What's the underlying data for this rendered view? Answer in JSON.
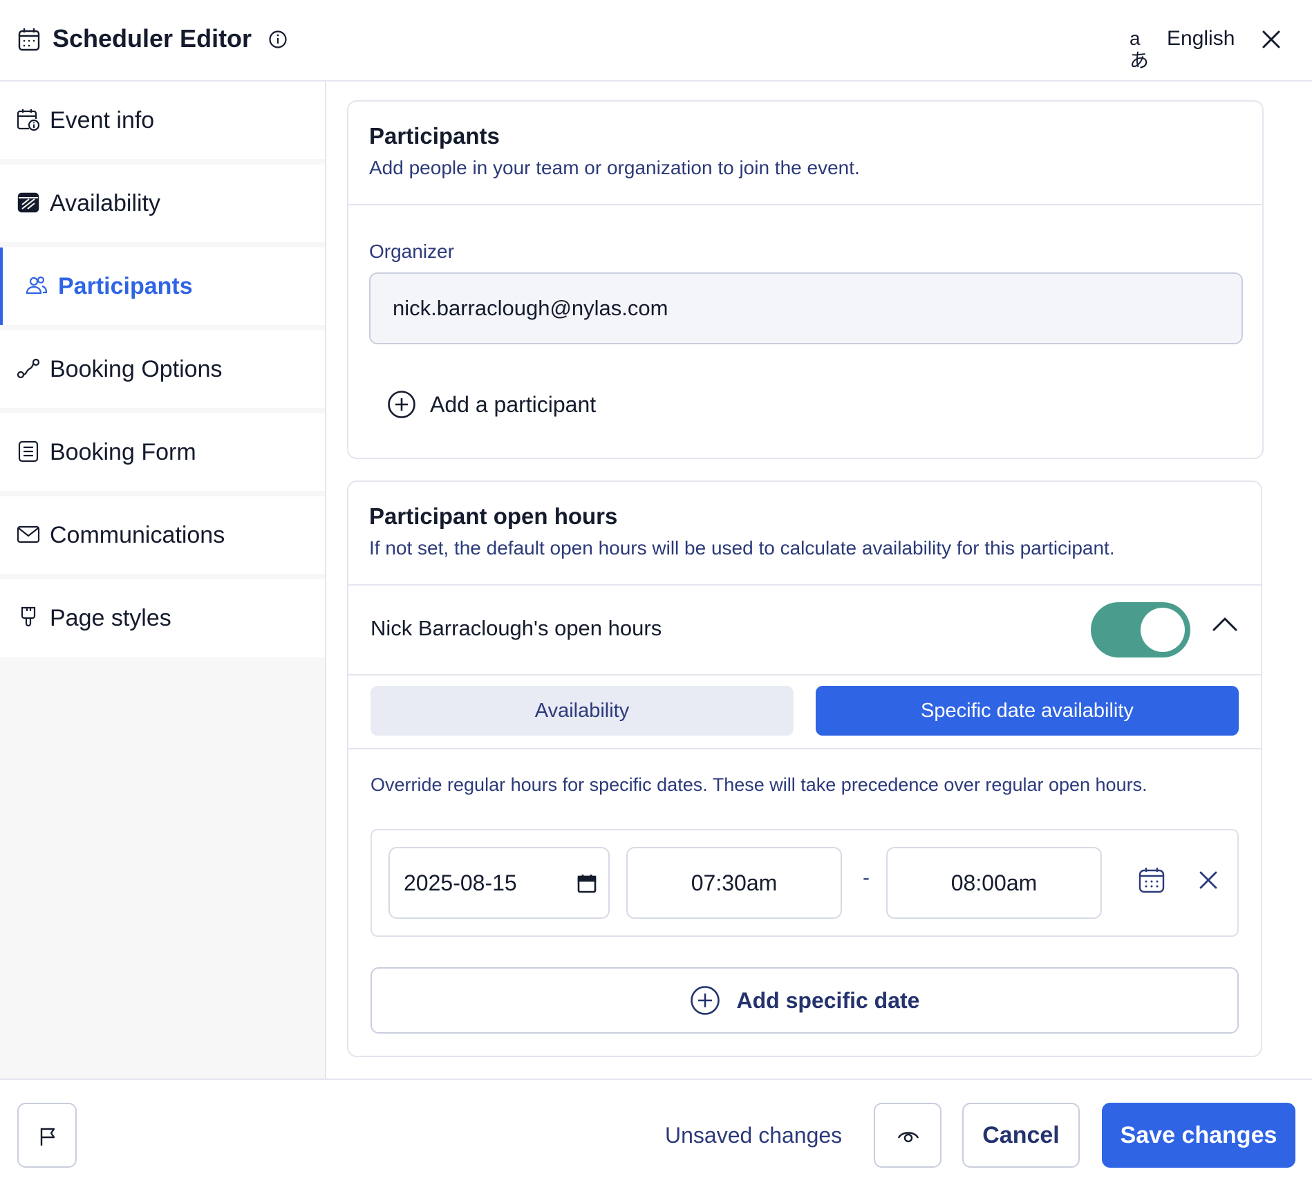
{
  "header": {
    "title": "Scheduler Editor",
    "language_glyph": "aあ",
    "language_label": "English"
  },
  "sidebar": {
    "items": [
      {
        "label": "Event info",
        "icon": "calendar-info-icon"
      },
      {
        "label": "Availability",
        "icon": "availability-icon"
      },
      {
        "label": "Participants",
        "icon": "users-icon",
        "active": true
      },
      {
        "label": "Booking Options",
        "icon": "route-icon"
      },
      {
        "label": "Booking Form",
        "icon": "form-icon"
      },
      {
        "label": "Communications",
        "icon": "mail-icon"
      },
      {
        "label": "Page styles",
        "icon": "paint-brush-icon"
      }
    ]
  },
  "participants_card": {
    "title": "Participants",
    "subtitle": "Add people in your team or organization to join the event.",
    "organizer_label": "Organizer",
    "organizer_value": "nick.barraclough@nylas.com",
    "add_participant_label": "Add a participant"
  },
  "open_hours_card": {
    "title": "Participant open hours",
    "subtitle": "If not set, the default open hours will be used to calculate availability for this participant.",
    "participant_label": "Nick Barraclough's open hours",
    "toggle_on": true,
    "tabs": [
      {
        "label": "Availability",
        "active": false
      },
      {
        "label": "Specific date availability",
        "active": true
      }
    ],
    "override_text": "Override regular hours for specific dates. These will take precedence over regular open hours.",
    "date_entry": {
      "date": "2025-08-15",
      "start_time": "07:30am",
      "separator": "-",
      "end_time": "08:00am"
    },
    "add_specific_date_label": "Add specific date"
  },
  "footer": {
    "unsaved_label": "Unsaved changes",
    "cancel_label": "Cancel",
    "save_label": "Save changes"
  },
  "colors": {
    "accent": "#2f64e4",
    "toggle_on": "#4a9d8c",
    "subtext": "#2c3a7a",
    "border": "#e3e6ee"
  }
}
